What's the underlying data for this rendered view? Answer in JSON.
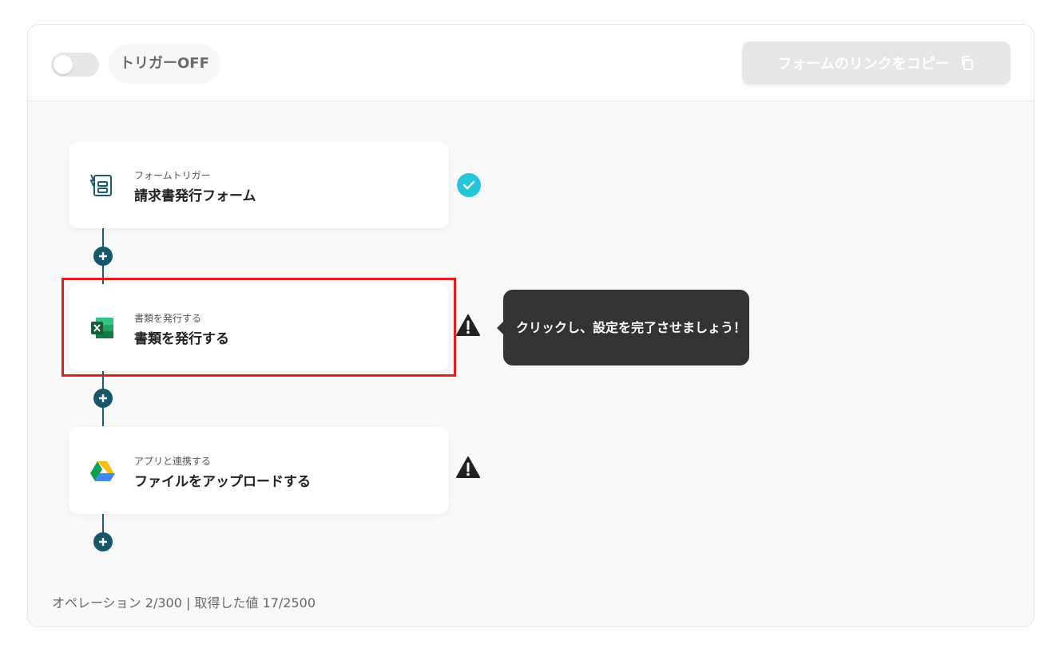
{
  "header": {
    "trigger_label": "トリガーOFF",
    "copy_button_label": "フォームのリンクをコピー"
  },
  "steps": [
    {
      "subtitle": "フォームトリガー",
      "title": "請求書発行フォーム",
      "icon": "form-icon",
      "status": "complete"
    },
    {
      "subtitle": "書類を発行する",
      "title": "書類を発行する",
      "icon": "excel-icon",
      "status": "warning"
    },
    {
      "subtitle": "アプリと連携する",
      "title": "ファイルをアップロードする",
      "icon": "google-drive-icon",
      "status": "warning"
    }
  ],
  "tooltip": {
    "text": "クリックし、設定を完了させましょう！"
  },
  "footer": {
    "usage": "オペレーション 2/300 | 取得した値 17/2500"
  },
  "colors": {
    "connector": "#1d5a6e",
    "complete": "#26c6da",
    "highlight": "#e01e1e",
    "tooltip_bg": "#333333"
  }
}
